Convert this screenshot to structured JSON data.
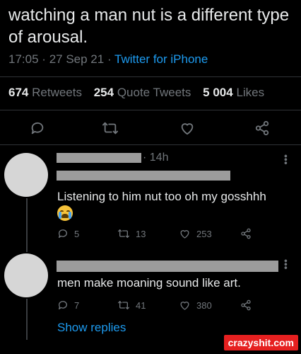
{
  "tweet": {
    "text": "watching a man nut is a different type of arousal.",
    "time": "17:05",
    "date": "27 Sep 21",
    "sep": "·",
    "source": "Twitter for iPhone",
    "retweets_count": "674",
    "retweets_label": "Retweets",
    "quotes_count": "254",
    "quotes_label": "Quote Tweets",
    "likes_count": "5 004",
    "likes_label": "Likes"
  },
  "actions": {
    "icons": [
      "reply-icon",
      "retweet-icon",
      "like-icon",
      "share-icon"
    ]
  },
  "replies": [
    {
      "time": "· 14h",
      "text": "Listening to him nut too oh my gosshhh",
      "emoji": "loudly-crying-face",
      "reply_count": "5",
      "retweet_count": "13",
      "like_count": "253"
    },
    {
      "text": "men make moaning sound like art.",
      "reply_count": "7",
      "retweet_count": "41",
      "like_count": "380",
      "show_replies": "Show replies"
    }
  ],
  "watermark": "crazyshit.com",
  "colors": {
    "background": "#000000",
    "text": "#e7e9ea",
    "muted": "#71767b",
    "link": "#1d9bf0",
    "watermark_bg": "#e62020"
  }
}
